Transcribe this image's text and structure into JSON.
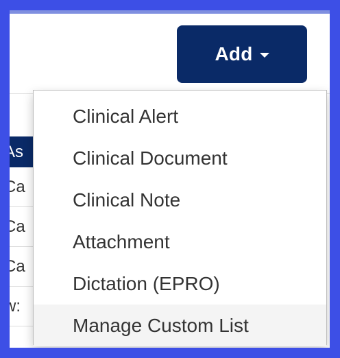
{
  "toolbar": {
    "add_button_label": "Add"
  },
  "add_menu": {
    "items": [
      {
        "label": "Clinical Alert"
      },
      {
        "label": "Clinical Document"
      },
      {
        "label": "Clinical Note"
      },
      {
        "label": "Attachment"
      },
      {
        "label": "Dictation (EPRO)"
      },
      {
        "label": "Manage Custom List"
      }
    ]
  },
  "table": {
    "header_fragment": "As",
    "row_fragments": [
      "Ca",
      "Ca",
      "Ca",
      "w:"
    ]
  },
  "colors": {
    "outer_background": "#3d4fe6",
    "button_bg": "#0a2a67",
    "menu_hover": "#f4f4f4"
  },
  "icons": {
    "add_caret": "caret-down-icon"
  }
}
